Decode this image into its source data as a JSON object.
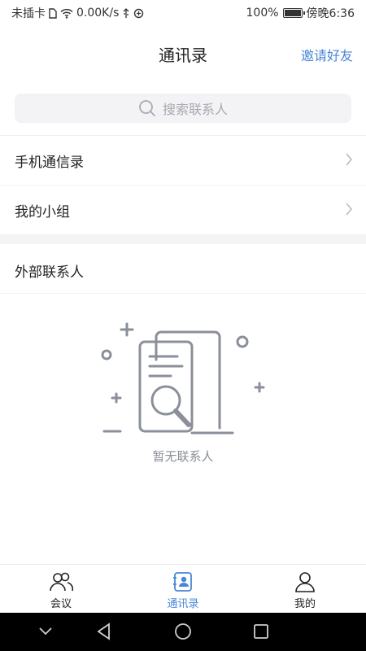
{
  "status_bar": {
    "carrier": "未插卡",
    "speed": "0.00K/s",
    "battery": "100%",
    "time": "傍晚6:36"
  },
  "header": {
    "title": "通讯录",
    "invite_label": "邀请好友"
  },
  "search": {
    "placeholder": "搜索联系人"
  },
  "menu": {
    "phone_contacts": "手机通信录",
    "my_groups": "我的小组"
  },
  "external": {
    "title": "外部联系人",
    "empty_text": "暂无联系人"
  },
  "tabs": [
    {
      "label": "会议",
      "icon": "people-icon",
      "active": false
    },
    {
      "label": "通讯录",
      "icon": "contacts-book-icon",
      "active": true
    },
    {
      "label": "我的",
      "icon": "person-icon",
      "active": false
    }
  ],
  "colors": {
    "accent": "#4a86d8",
    "illustration": "#8a8f99"
  }
}
